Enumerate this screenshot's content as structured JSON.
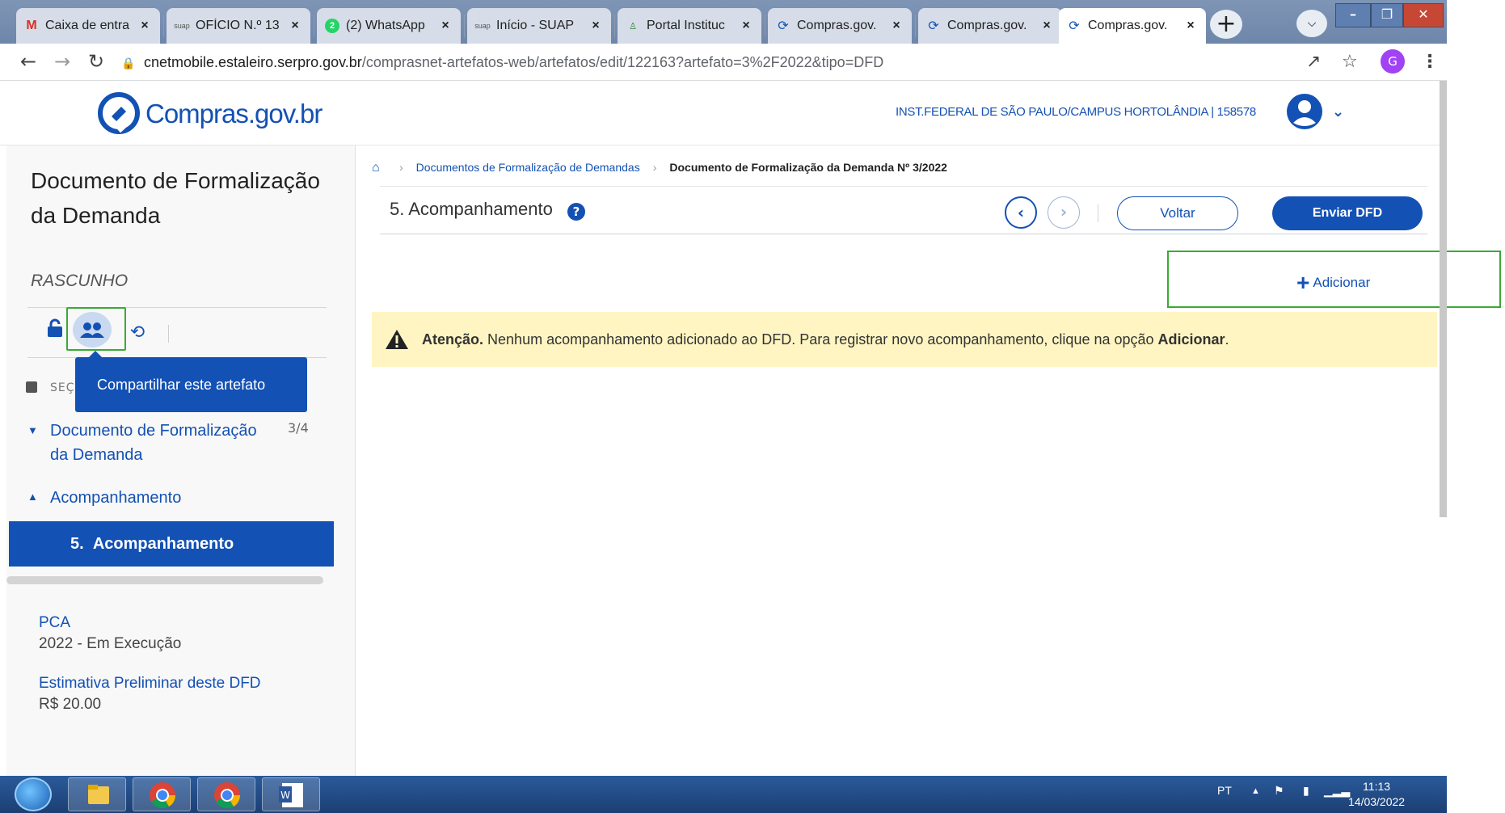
{
  "browser": {
    "tabs": [
      {
        "title": "Caixa de entra",
        "favicon": "gmail-icon",
        "glyph": "M"
      },
      {
        "title": "OFÍCIO N.º 13",
        "favicon": "suap-icon",
        "glyph": "suap"
      },
      {
        "title": "(2) WhatsApp",
        "favicon": "whatsapp-icon",
        "glyph": "2"
      },
      {
        "title": "Início - SUAP",
        "favicon": "suap-icon",
        "glyph": "suap"
      },
      {
        "title": "Portal Instituc",
        "favicon": "portal-icon",
        "glyph": "♙"
      },
      {
        "title": "Compras.gov.",
        "favicon": "compras-icon",
        "glyph": "⟳"
      },
      {
        "title": "Compras.gov.",
        "favicon": "compras-icon",
        "glyph": "⟳"
      },
      {
        "title": "Compras.gov.",
        "favicon": "compras-icon",
        "glyph": "⟳"
      }
    ],
    "close_glyph": "×",
    "new_tab_glyph": "+",
    "url_host": "cnetmobile.estaleiro.serpro.gov.br",
    "url_path": "/comprasnet-artefatos-web/artefatos/edit/122163?artefato=3%2F2022&tipo=DFD",
    "profile_initial": "G"
  },
  "header": {
    "logo_text": "Compras.gov.br",
    "organization": "INST.FEDERAL DE SÃO PAULO/CAMPUS HORTOLÂNDIA | 158578"
  },
  "sidebar": {
    "title": "Documento de Formalização da Demanda",
    "status": "RASCUNHO",
    "tooltip": "Compartilhar este artefato",
    "sections_label": "SEÇ",
    "items": [
      {
        "label": "Documento de Formalização da Demanda",
        "count": "3/4",
        "expanded": true
      },
      {
        "label": "Acompanhamento",
        "expanded": false
      }
    ],
    "active_item": {
      "number": "5.",
      "label": "Acompanhamento"
    },
    "pca_label": "PCA",
    "pca_value": "2022 - Em Execução",
    "estimate_label": "Estimativa Preliminar deste DFD",
    "estimate_value": "R$ 20.00"
  },
  "breadcrumb": {
    "items": [
      "Documentos de Formalização de Demandas",
      "Documento de Formalização da Demanda Nº 3/2022"
    ]
  },
  "page": {
    "title": "5. Acompanhamento",
    "back_label": "Voltar",
    "send_label": "Enviar DFD",
    "add_label": "Adicionar"
  },
  "alert": {
    "strong": "Atenção.",
    "text": " Nenhum acompanhamento adicionado ao DFD. Para registrar novo acompanhamento, clique na opção ",
    "strong_end": "Adicionar",
    "end": "."
  },
  "taskbar": {
    "language": "PT",
    "time": "11:13",
    "date": "14/03/2022"
  },
  "colors": {
    "brand_blue": "#1351b4",
    "highlight_green": "#3aaa35",
    "alert_bg": "#fff5c2"
  }
}
